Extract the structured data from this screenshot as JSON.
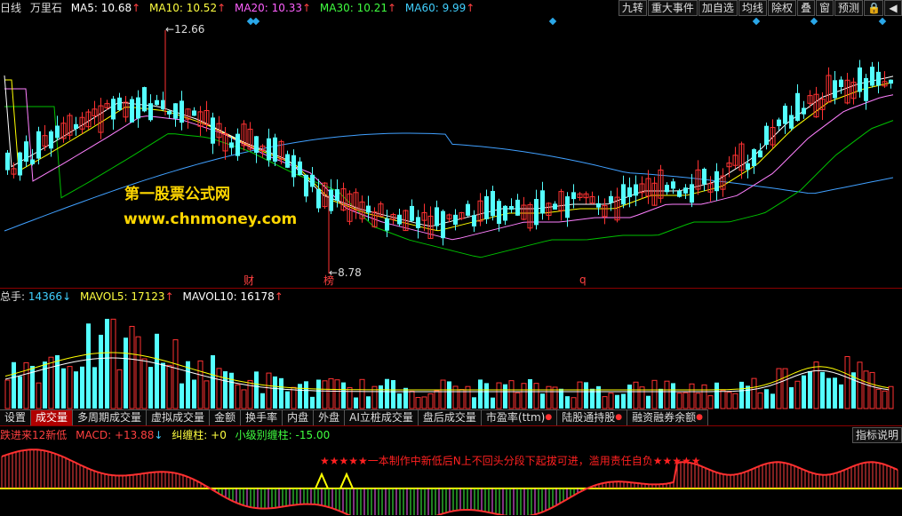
{
  "header": {
    "period": "日线",
    "stock_name": "万里石",
    "ma5_label": "MA5:",
    "ma5": "10.68",
    "ma10_label": "MA10:",
    "ma10": "10.52",
    "ma20_label": "MA20:",
    "ma20": "10.33",
    "ma30_label": "MA30:",
    "ma30": "10.21",
    "ma60_label": "MA60:",
    "ma60": "9.99",
    "arrow_up": "↑",
    "arrow_down": "↓"
  },
  "toolbar": [
    "九转",
    "重大事件",
    "加自选",
    "均线",
    "除权",
    "叠",
    "窗",
    "预测"
  ],
  "price_chart": {
    "high_label": "12.66",
    "low_label": "8.78",
    "marker_cai": "财",
    "marker_bang": "榜",
    "marker_q": "q",
    "watermark_1": "第一股票公式网",
    "watermark_2": "www.chnmoney.com"
  },
  "volume": {
    "total_label": "总手:",
    "total": "14366",
    "mavol5_label": "MAVOL5:",
    "mavol5": "17123",
    "mavol10_label": "MAVOL10:",
    "mavol10": "16178"
  },
  "tabs": [
    "设置",
    "成交量",
    "多周期成交量",
    "虚拟成交量",
    "金额",
    "换手率",
    "内盘",
    "外盘",
    "AI立桩成交量",
    "盘后成交量",
    "市盈率(ttm)",
    "陆股通持股",
    "融资融券余额"
  ],
  "indicator": {
    "name": "跌进来12新低",
    "macd_label": "MACD:",
    "macd": "+13.88",
    "jiuchan_label": "纠缠柱:",
    "jiuchan": "+0",
    "xiaoji_label": "小级别缠柱:",
    "xiaoji": "-15.00",
    "notice": "★★★★★一本制作中新低后N上不回头分段下起拔可进，滥用责任自负★★★★★",
    "help_button": "指标说明"
  },
  "colors": {
    "up": "#ff3232",
    "down": "#54ffff",
    "ma5": "#ffffff",
    "ma10": "#ffff00",
    "ma20": "#ff80ff",
    "ma30": "#00c000",
    "ma60": "#40a0ff",
    "diamond": "#2aa7e8"
  }
}
